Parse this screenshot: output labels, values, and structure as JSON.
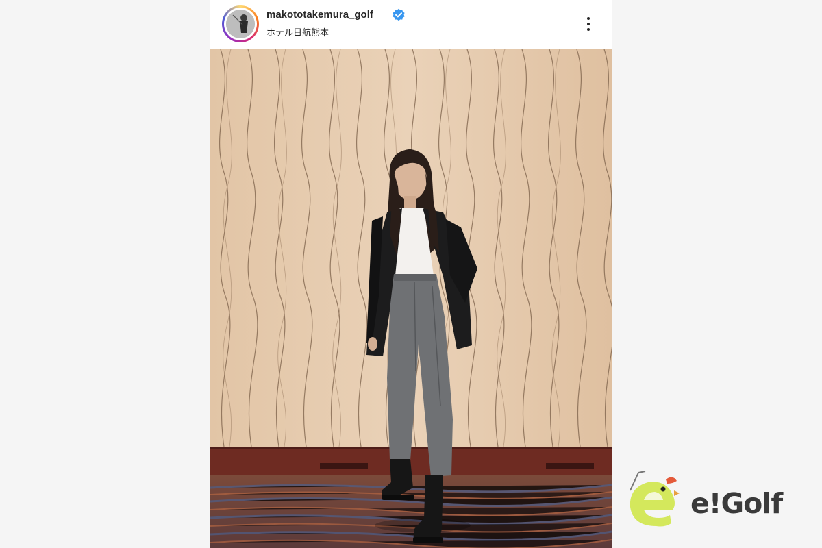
{
  "post": {
    "username": "makototakemura_golf",
    "location": "ホテル日航熊本",
    "verified": true,
    "more_icon": "more-vertical-icon"
  },
  "photo": {
    "scene": "person"
  },
  "logo": {
    "text": "e!Golf",
    "mascot_color": "#d4e85c",
    "accent_color": "#e45a3a"
  }
}
